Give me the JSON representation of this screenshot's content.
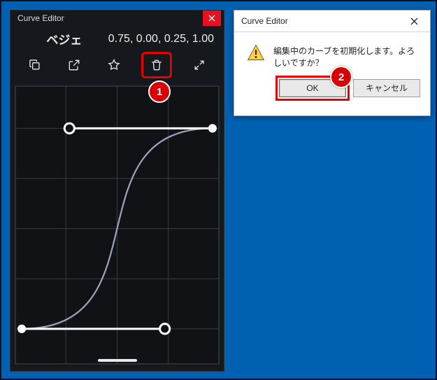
{
  "curve_editor": {
    "title": "Curve Editor",
    "curve_name": "ベジェ",
    "bezier_params_text": "0.75, 0.00, 0.25, 1.00",
    "bezier": {
      "p1x": 0.75,
      "p1y": 0.0,
      "p2x": 0.25,
      "p2y": 1.0
    },
    "toolbar": {
      "copy_icon": "copy",
      "popout_icon": "open-external",
      "favorite_icon": "star",
      "delete_icon": "trash",
      "expand_icon": "expand-arrows"
    }
  },
  "dialog": {
    "title": "Curve Editor",
    "message": "編集中のカーブを初期化します。よろしいですか？",
    "ok_label": "OK",
    "cancel_label": "キャンセル",
    "icon": "warning"
  },
  "annotations": {
    "badge1": "1",
    "badge2": "2"
  },
  "colors": {
    "desktop_bg": "#0061b3",
    "panel_bg": "#15181c",
    "highlight": "#e70000",
    "close_red": "#e81123"
  }
}
